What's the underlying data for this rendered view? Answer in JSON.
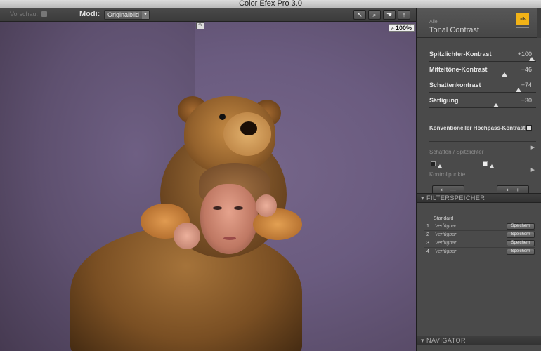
{
  "window": {
    "title": "Color Efex Pro 3.0"
  },
  "toolbar": {
    "preview_label": "Vorschau:",
    "modes_label": "Modi:",
    "mode_value": "Originalbild",
    "tools": [
      {
        "name": "arrow",
        "glyph": "↖"
      },
      {
        "name": "zoom",
        "glyph": "🔍"
      },
      {
        "name": "hand",
        "glyph": "✋"
      },
      {
        "name": "eyedropper",
        "glyph": "↑"
      }
    ]
  },
  "canvas": {
    "zoom_label": "100%",
    "split_handle": "↷"
  },
  "panel": {
    "category": "Alle",
    "filter_name": "Tonal Contrast",
    "logo_text": "nik",
    "sliders": [
      {
        "label": "Spitzlichter-Kontrast",
        "value": "+100",
        "position": 1.0
      },
      {
        "label": "Mitteltöne-Kontrast",
        "value": "+46",
        "position": 0.73
      },
      {
        "label": "Schattenkontrast",
        "value": "+74",
        "position": 0.87
      },
      {
        "label": "Sättigung",
        "value": "+30",
        "position": 0.65
      }
    ],
    "checkbox_label": "Konventioneller Hochpass-Kontrast",
    "shadows_highlights_label": "Schatten / Spitzlichter",
    "control_points_label": "Kontrollpunkte",
    "cp_minus": "⟵ —",
    "cp_plus": "⟵ +",
    "filter_memory_header": "FILTERSPEICHER",
    "preset_standard": "Standard",
    "presets": [
      {
        "num": "1",
        "name": "Verfügbar",
        "save": "Speichern"
      },
      {
        "num": "2",
        "name": "Verfügbar",
        "save": "Speichern"
      },
      {
        "num": "3",
        "name": "Verfügbar",
        "save": "Speichern"
      },
      {
        "num": "4",
        "name": "Verfügbar",
        "save": "Speichern"
      }
    ],
    "navigator_header": "NAVIGATOR"
  }
}
